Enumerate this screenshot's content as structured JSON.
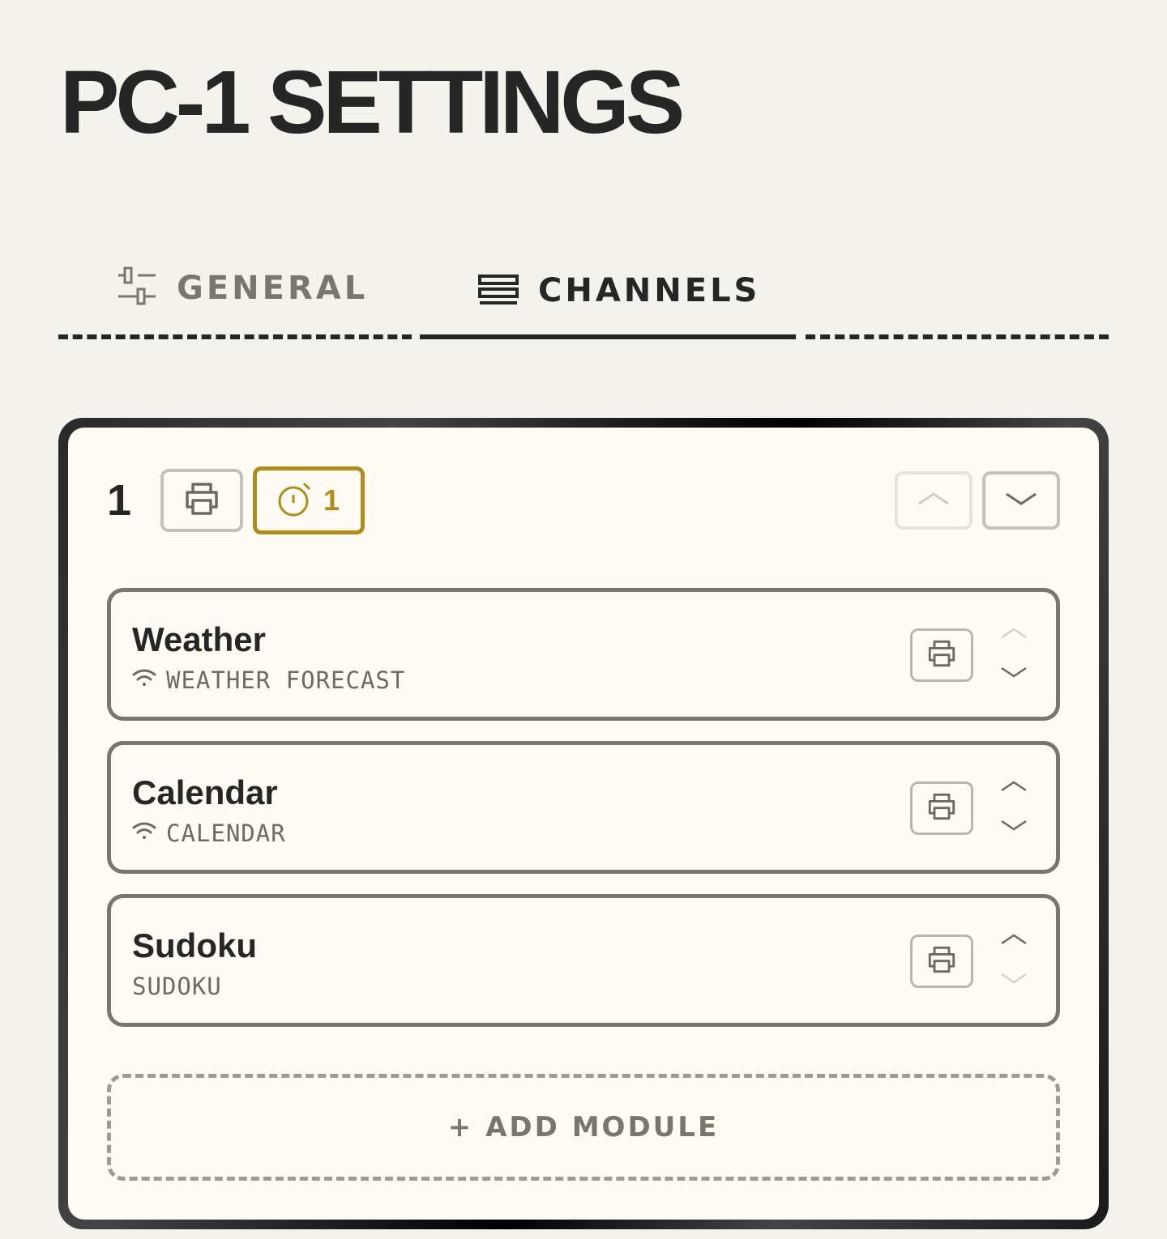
{
  "page": {
    "title": "PC-1 SETTINGS"
  },
  "tabs": [
    {
      "label": "GENERAL",
      "icon": "sliders-icon",
      "active": false
    },
    {
      "label": "CHANNELS",
      "icon": "channels-icon",
      "active": true
    }
  ],
  "channel": {
    "number": "1",
    "schedule_count": "1",
    "accent_color": "#b08c1c",
    "modules": [
      {
        "name": "Weather",
        "type": "WEATHER FORECAST",
        "icon": "wifi-icon"
      },
      {
        "name": "Calendar",
        "type": "CALENDAR",
        "icon": "wifi-icon"
      },
      {
        "name": "Sudoku",
        "type": "SUDOKU",
        "icon": null
      }
    ],
    "add_module_label": "+ ADD MODULE"
  }
}
